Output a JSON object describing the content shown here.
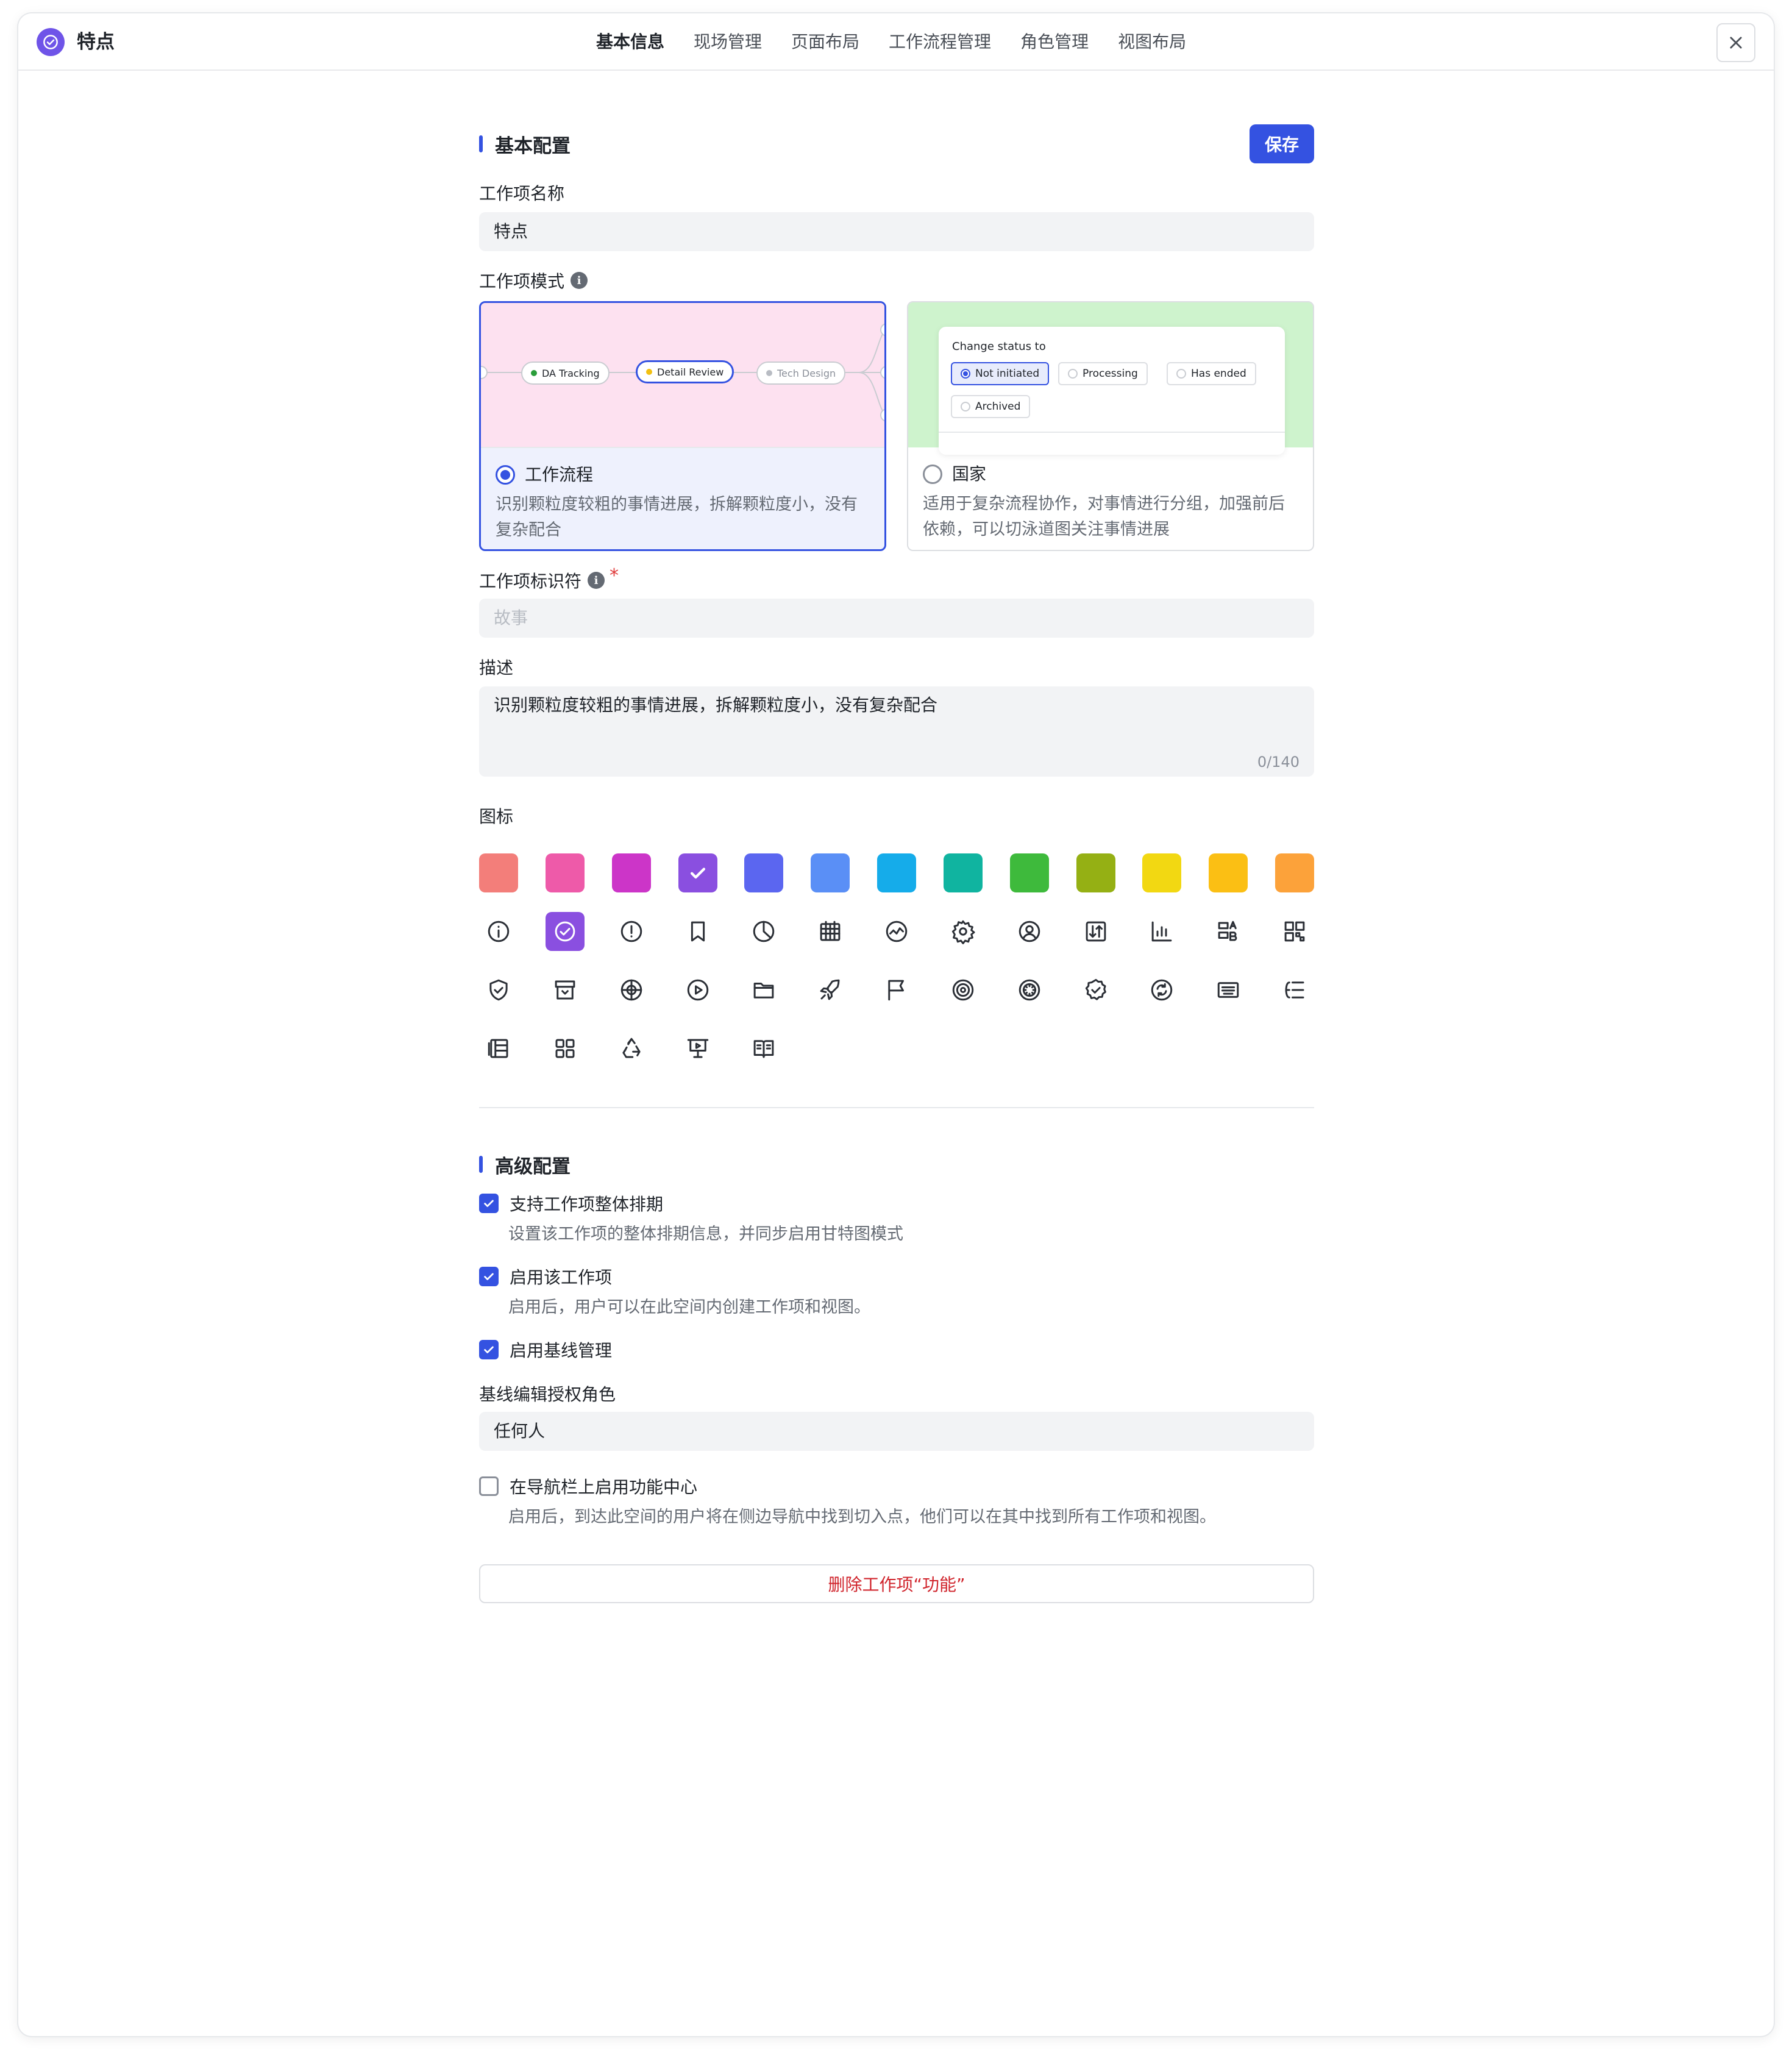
{
  "header": {
    "title": "特点",
    "tabs": [
      "基本信息",
      "现场管理",
      "页面布局",
      "工作流程管理",
      "角色管理",
      "视图布局"
    ],
    "active_tab": "基本信息"
  },
  "basic": {
    "section_title": "基本配置",
    "save_label": "保存",
    "name_label": "工作项名称",
    "name_value": "特点",
    "mode_label": "工作项模式",
    "modes": [
      {
        "name": "工作流程",
        "desc": "识别颗粒度较粗的事情进展，拆解颗粒度小，没有复杂配合",
        "selected": true,
        "preview_nodes": [
          "DA Tracking",
          "Detail Review",
          "Tech Design"
        ]
      },
      {
        "name": "国家",
        "desc": "适用于复杂流程协作，对事情进行分组，加强前后依赖，可以切泳道图关注事情进展",
        "selected": false,
        "preview_title": "Change status to",
        "preview_statuses": [
          "Not initiated",
          "Processing",
          "Has ended",
          "Archived"
        ]
      }
    ],
    "identifier_label": "工作项标识符",
    "identifier_required_mark": "*",
    "identifier_placeholder": "故事",
    "desc_label": "描述",
    "desc_value": "识别颗粒度较粗的事情进展，拆解颗粒度小，没有复杂配合",
    "desc_counter": "0/140",
    "icon_label": "图标",
    "colors": [
      "#f37e7a",
      "#ee5aa9",
      "#cc35c8",
      "#8a4fe0",
      "#5b66f0",
      "#5a8ff6",
      "#15acea",
      "#10b4a0",
      "#3eba3c",
      "#95b014",
      "#f2d812",
      "#fbbf14",
      "#fca23a"
    ],
    "selected_color_index": 3,
    "icons": [
      "info-circle-icon",
      "check-circle-icon",
      "alert-circle-icon",
      "bookmark-icon",
      "pie-chart-icon",
      "calendar-icon",
      "dashboard-icon",
      "gear-icon",
      "user-circle-icon",
      "sort-icon",
      "bar-chart-icon",
      "ab-layout-icon",
      "qr-grid-icon",
      "shield-check-icon",
      "archive-icon",
      "crosshair-icon",
      "play-circle-icon",
      "folder-icon",
      "rocket-icon",
      "flag-icon",
      "target-icon",
      "aperture-icon",
      "badge-check-icon",
      "refresh-circle-icon",
      "keyboard-icon",
      "indent-list-icon",
      "layers-icon",
      "grid-icon",
      "recycle-icon",
      "presentation-icon",
      "book-icon"
    ],
    "selected_icon_index": 1
  },
  "advanced": {
    "section_title": "高级配置",
    "options": [
      {
        "label": "支持工作项整体排期",
        "hint": "设置该工作项的整体排期信息，并同步启用甘特图模式",
        "checked": true
      },
      {
        "label": "启用该工作项",
        "hint": "启用后，用户可以在此空间内创建工作项和视图。",
        "checked": true
      },
      {
        "label": "启用基线管理",
        "hint": "",
        "checked": true
      }
    ],
    "baseline_role_label": "基线编辑授权角色",
    "baseline_role_value": "任何人",
    "nav_option": {
      "label": "在导航栏上启用功能中心",
      "hint": "启用后，到达此空间的用户将在侧边导航中找到切入点，他们可以在其中找到所有工作项和视图。",
      "checked": false
    },
    "delete_label": "删除工作项“功能”"
  }
}
